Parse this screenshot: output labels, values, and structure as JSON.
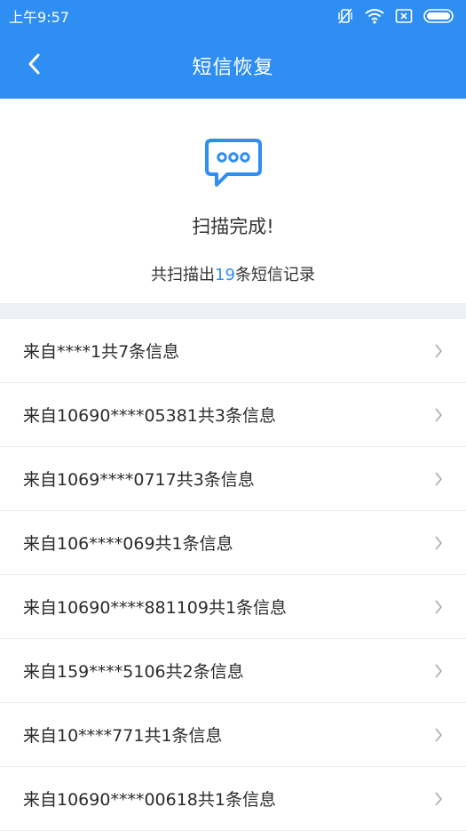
{
  "status_bar": {
    "time": "上午9:57"
  },
  "header": {
    "title": "短信恢复"
  },
  "summary": {
    "scan_title": "扫描完成!",
    "scan_prefix": "共扫描出",
    "scan_count": "19",
    "scan_suffix": "条短信记录"
  },
  "colors": {
    "accent": "#2f8ef1"
  },
  "list": {
    "items": [
      {
        "label": "来自****1共7条信息"
      },
      {
        "label": "来自10690****05381共3条信息"
      },
      {
        "label": "来自1069****0717共3条信息"
      },
      {
        "label": "来自106****069共1条信息"
      },
      {
        "label": "来自10690****881109共1条信息"
      },
      {
        "label": "来自159****5106共2条信息"
      },
      {
        "label": "来自10****771共1条信息"
      },
      {
        "label": "来自10690****00618共1条信息"
      }
    ]
  }
}
